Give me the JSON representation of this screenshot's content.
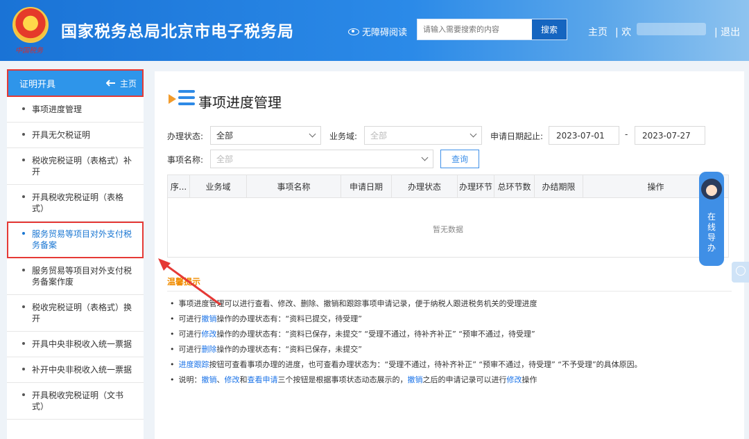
{
  "header": {
    "emblem_text": "中国税务",
    "site_title": "国家税务总局北京市电子税务局",
    "accessibility_label": "无障碍阅读",
    "search_placeholder": "请输入需要搜索的内容",
    "search_button": "搜索",
    "home_link": "主页",
    "welcome_prefix": "| 欢",
    "logout_link": "| 退出"
  },
  "sidebar": {
    "section_title": "证明开具",
    "home_label": "主页",
    "items": [
      {
        "label": "事项进度管理"
      },
      {
        "label": "开具无欠税证明"
      },
      {
        "label": "税收完税证明（表格式）补开"
      },
      {
        "label": "开具税收完税证明（表格式）"
      },
      {
        "label": "服务贸易等项目对外支付税务备案"
      },
      {
        "label": "服务贸易等项目对外支付税务备案作废"
      },
      {
        "label": "税收完税证明（表格式）换开"
      },
      {
        "label": "开具中央非税收入统一票据"
      },
      {
        "label": "补开中央非税收入统一票据"
      },
      {
        "label": "开具税收完税证明（文书式）"
      }
    ]
  },
  "main": {
    "title": "事项进度管理",
    "filters": {
      "status_label": "办理状态:",
      "status_value": "全部",
      "domain_label": "业务域:",
      "domain_placeholder": "全部",
      "date_label": "申请日期起止:",
      "date_start": "2023-07-01",
      "date_sep": "-",
      "date_end": "2023-07-27",
      "name_label": "事项名称:",
      "name_placeholder": "全部",
      "query_button": "查询"
    },
    "table": {
      "columns": [
        "序...",
        "业务域",
        "事项名称",
        "申请日期",
        "办理状态",
        "办理环节",
        "总环节数",
        "办结期限",
        "操作"
      ],
      "empty_text": "暂无数据"
    },
    "tips": {
      "title": "温馨提示",
      "line1": "事项进度管理可以进行查看、修改、删除、撤销和跟踪事项申请记录，便于纳税人跟进税务机关的受理进度",
      "line2_a": "可进行",
      "line2_k": "撤销",
      "line2_b": "操作的办理状态有：“资料已提交，待受理”",
      "line3_a": "可进行",
      "line3_k": "修改",
      "line3_b": "操作的办理状态有：“资料已保存，未提交” “受理不通过，待补齐补正” “预审不通过，待受理”",
      "line4_a": "可进行",
      "line4_k": "删除",
      "line4_b": "操作的办理状态有：“资料已保存，未提交”",
      "line5_k": "进度跟踪",
      "line5_b": "按钮可查看事项办理的进度，也可查看办理状态为：“受理不通过，待补齐补正” “预审不通过，待受理” “不予受理”的具体原因。",
      "line6_a": "说明：",
      "line6_k1": "撤销",
      "line6_s1": "、",
      "line6_k2": "修改",
      "line6_s2": "和",
      "line6_k3": "查看申请",
      "line6_b": "三个按钮是根据事项状态动态展示的，",
      "line6_k4": "撤销",
      "line6_c": "之后的申请记录可以进行",
      "line6_k5": "修改",
      "line6_d": "操作"
    }
  },
  "guide": {
    "label": "在线导办"
  }
}
